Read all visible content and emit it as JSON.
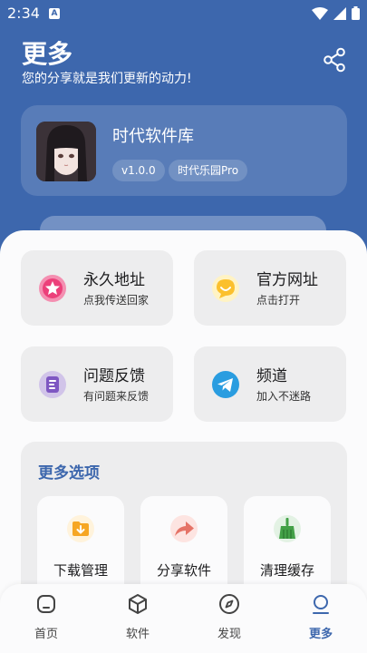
{
  "status_bar": {
    "time": "2:34",
    "notification_letter": "A"
  },
  "header": {
    "title": "更多",
    "subtitle": "您的分享就是我们更新的动力!"
  },
  "app_info": {
    "name": "时代软件库",
    "version": "v1.0.0",
    "edition": "时代乐园Pro"
  },
  "cards": [
    {
      "title": "永久地址",
      "subtitle": "点我传送回家",
      "icon": "star-icon",
      "color": "#f06292"
    },
    {
      "title": "官方网址",
      "subtitle": "点击打开",
      "icon": "smile-chat-icon",
      "color": "#fbc02d"
    },
    {
      "title": "问题反馈",
      "subtitle": "有问题来反馈",
      "icon": "feedback-doc-icon",
      "color": "#7e57c2"
    },
    {
      "title": "频道",
      "subtitle": "加入不迷路",
      "icon": "telegram-icon",
      "color": "#2a9de0"
    }
  ],
  "more_options": {
    "title": "更多选项",
    "items": [
      {
        "label": "下载管理",
        "icon": "download-folder-icon",
        "color": "#f6a623"
      },
      {
        "label": "分享软件",
        "icon": "share-arrow-icon",
        "color": "#e57367"
      },
      {
        "label": "清理缓存",
        "icon": "broom-icon",
        "color": "#43a047"
      }
    ]
  },
  "tabs": [
    {
      "label": "首页",
      "icon": "home-icon"
    },
    {
      "label": "软件",
      "icon": "cube-icon"
    },
    {
      "label": "发现",
      "icon": "compass-icon"
    },
    {
      "label": "更多",
      "icon": "more-person-icon",
      "active": true
    }
  ],
  "colors": {
    "primary": "#3d67ad",
    "background": "#fbfbfc",
    "card": "#ededee"
  }
}
